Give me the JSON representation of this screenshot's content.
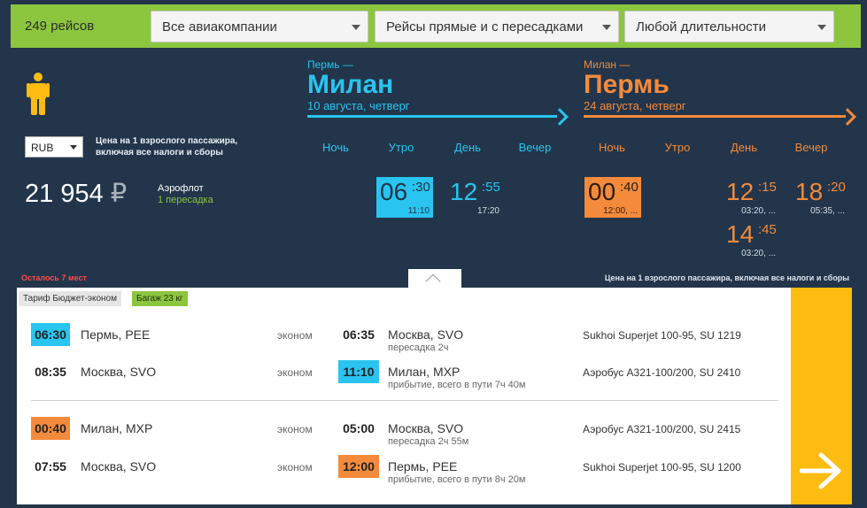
{
  "filters": {
    "flights_count": "249 рейсов",
    "airlines": "Все авиакомпании",
    "stops": "Рейсы прямые и с пересадками",
    "duration": "Любой длительности"
  },
  "header": {
    "currency": "RUB",
    "price_note": "Цена на 1 взрослого пассажира, включая все налоги и сборы",
    "outbound": {
      "from": "Пермь —",
      "to": "Милан",
      "date": "10 августа, четверг"
    },
    "return": {
      "from": "Милан —",
      "to": "Пермь",
      "date": "24 августа, четверг"
    },
    "times_of_day": [
      "Ночь",
      "Утро",
      "День",
      "Вечер"
    ]
  },
  "result": {
    "price": "21 954",
    "currency_symbol": "₽",
    "airline": "Аэрофлот",
    "stops": "1 пересадка",
    "seats_left": "Осталось 7 мест",
    "price_note": "Цена на 1 взрослого пассажира, включая все налоги и сборы",
    "outbound_slots": [
      {
        "hh": "06",
        "mm": ":30",
        "arr": "11:10"
      },
      {
        "hh": "12",
        "mm": ":55",
        "arr": "17:20"
      }
    ],
    "return_slots": [
      {
        "hh": "00",
        "mm": ":40",
        "arr": "12:00, ..."
      },
      {
        "hh": "12",
        "mm": ":15",
        "arr": "03:20, ..."
      },
      {
        "hh": "18",
        "mm": ":20",
        "arr": "05:35, ..."
      },
      {
        "hh": "14",
        "mm": ":45",
        "arr": "03:20, ..."
      }
    ]
  },
  "details": {
    "tariff": "Тариф Бюджет-эконом",
    "baggage": "Багаж 23 кг",
    "segments": [
      {
        "dep_time": "06:30",
        "dep_city": "Пермь, PEE",
        "class": "эконом",
        "arr_time": "06:35",
        "arr_city": "Москва, SVO",
        "note": "пересадка 2ч",
        "aircraft": "Sukhoi Superjet 100-95, SU 1219"
      },
      {
        "dep_time": "08:35",
        "dep_city": "Москва, SVO",
        "class": "эконом",
        "arr_time": "11:10",
        "arr_city": "Милан, MXP",
        "note": "прибытие, всего в пути 7ч 40м",
        "aircraft": "Аэробус А321-100/200, SU 2410"
      },
      {
        "dep_time": "00:40",
        "dep_city": "Милан, MXP",
        "class": "эконом",
        "arr_time": "05:00",
        "arr_city": "Москва, SVO",
        "note": "пересадка 2ч 55м",
        "aircraft": "Аэробус А321-100/200, SU 2415"
      },
      {
        "dep_time": "07:55",
        "dep_city": "Москва, SVO",
        "class": "эконом",
        "arr_time": "12:00",
        "arr_city": "Пермь, PEE",
        "note": "прибытие, всего в пути 8ч 20м",
        "aircraft": "Sukhoi Superjet 100-95, SU 1200"
      }
    ]
  },
  "colors": {
    "outbound": "#29c4f0",
    "return": "#f48a3c",
    "accent": "#8cc63f",
    "go_button": "#fcbc12",
    "background": "#22354a"
  }
}
